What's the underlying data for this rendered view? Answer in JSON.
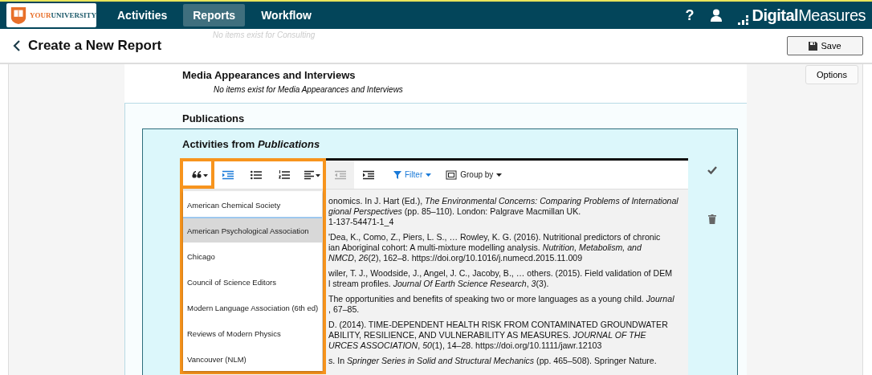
{
  "header": {
    "logo_primary": "YOUR",
    "logo_secondary": "UNIVERSITY",
    "nav": [
      {
        "label": "Activities",
        "selected": false
      },
      {
        "label": "Reports",
        "selected": true
      },
      {
        "label": "Workflow",
        "selected": false
      }
    ],
    "help_glyph": "?",
    "brand": "**Digital**Measures"
  },
  "page": {
    "title": "Create a New Report",
    "ghost_note": "No items exist for Consulting",
    "save_label": "Save",
    "options_label": "Options"
  },
  "sections": {
    "media": {
      "heading": "Media Appearances and Interviews",
      "note": "No items exist for Media Appearances and Interviews"
    },
    "publications": {
      "heading": "Publications",
      "card_heading": "Activities from *Publications*"
    }
  },
  "toolbar": [
    {
      "kind": "quote",
      "on": false,
      "disabled": false
    },
    {
      "kind": "indent",
      "on": true,
      "disabled": false
    },
    {
      "kind": "bullets",
      "on": false,
      "disabled": false
    },
    {
      "kind": "numbered",
      "on": false,
      "disabled": false
    },
    {
      "kind": "align",
      "on": false,
      "disabled": false
    },
    {
      "kind": "outdent",
      "on": false,
      "disabled": true
    },
    {
      "kind": "indent",
      "on": false,
      "disabled": false
    },
    {
      "kind": "filter",
      "label": "Filter"
    },
    {
      "kind": "group",
      "label": "Group by"
    }
  ],
  "citation_styles": [
    {
      "label": "American Chemical Society",
      "selected": false
    },
    {
      "label": "American Psychological Association",
      "selected": true
    },
    {
      "label": "Chicago",
      "selected": false
    },
    {
      "label": "Council of Science Editors",
      "selected": false
    },
    {
      "label": "Modern Language Association (6th ed)",
      "selected": false
    },
    {
      "label": "Reviews of Modern Physics",
      "selected": false
    },
    {
      "label": "Vancouver (NLM)",
      "selected": false
    }
  ],
  "references": [
    [
      "onomics. In J. Hart (Ed.), *The Environmental Concerns: Comparing Problems of International*",
      "*gional Perspectives* (pp. 85–110). London: Palgrave Macmillan UK.",
      "1-137-54471-1_4"
    ],
    [
      "'Dea, K., Como, Z., Piers, L. S., … Rowley, K. G. (2016). Nutritional predictors of chronic",
      "ian Aboriginal cohort: A multi-mixture modelling analysis. *Nutrition, Metabolism, and*",
      "*NMCD*, *26*(2), 162–8. https://doi.org/10.1016/j.numecd.2015.11.009"
    ],
    [
      "wiler, T. J., Woodside, J., Angel, J. C., Jacoby, B., … others. (2015). Field validation of DEM",
      "l stream profiles. *Journal Of Earth Science Research*, *3*(3)."
    ],
    [
      "The opportunities and benefits of speaking two or more languages as a young child. *Journal*",
      ", 67–85."
    ],
    [
      "D. (2014). TIME-DEPENDENT HEALTH RISK FROM CONTAMINATED GROUNDWATER",
      "ABILITY, RESILIENCE, AND VULNERABILITY AS MEASURES. *JOURNAL OF THE*",
      "*URCES ASSOCIATION*, *50*(1), 14–28. https://doi.org/10.1111/jawr.12103"
    ],
    [
      "s. In *Springer Series in Solid and Structural Mechanics* (pp. 465–508). Springer Nature."
    ]
  ]
}
